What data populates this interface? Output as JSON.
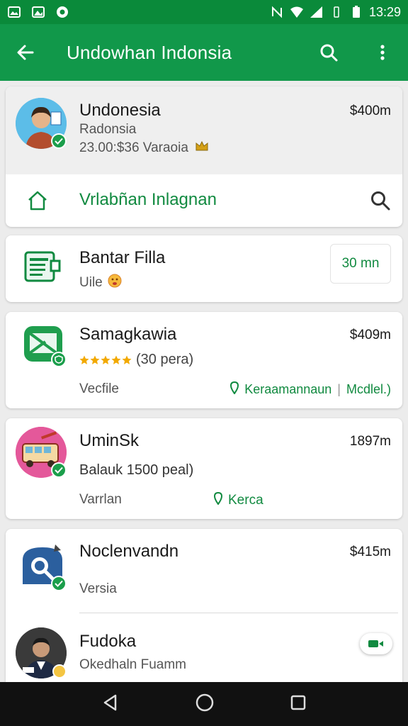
{
  "status_bar": {
    "time": "13:29",
    "icons": [
      "gallery-icon",
      "image-icon",
      "record-icon",
      "nfc-icon",
      "wifi-icon",
      "signal-icon",
      "vibrate-icon",
      "battery-icon"
    ]
  },
  "app_bar": {
    "title": "Undowhan Indonsia",
    "icons": [
      "back-arrow-icon",
      "search-icon",
      "more-vert-icon"
    ]
  },
  "colors": {
    "status_bar": "#0a8a3a",
    "app_bar": "#11984a",
    "accent_green": "#118a40",
    "verified": "#1b9e4b",
    "star": "#f2a900"
  },
  "profile_card": {
    "name": "Undonesia",
    "subtitle": "Radonsia",
    "detail": "23.00:$36 Varaoia",
    "price": "$400m",
    "search_row_label": "Vrlabñan Inlagnan"
  },
  "items": [
    {
      "title": "Bantar Filla",
      "subtitle": "Uile",
      "badge": "30 mn",
      "icon": "document-icon"
    },
    {
      "title": "Samagkawia",
      "price": "$409m",
      "rating_text": "(30 pera)",
      "stars": 5,
      "footer_left": "Vecfile",
      "footer_link": "Keraamannaun",
      "footer_sep": "|",
      "footer_right": "Mcdlel.)",
      "icon": "map-icon"
    },
    {
      "title": "UminSk",
      "price": "1897m",
      "subtitle": "Balauk 1500 peal)",
      "footer_left": "Varrlan",
      "footer_link": "Kerca",
      "icon": "bus-icon"
    },
    {
      "title": "Noclenvandn",
      "price": "$415m",
      "subtitle": "Versia",
      "icon": "magnifier-location-icon"
    },
    {
      "title": "Fudoka",
      "subtitle": "Okedhaln Fuamm",
      "icon": "person-avatar-icon",
      "action_icon": "video-icon"
    }
  ],
  "nav_bar": {
    "icons": [
      "back-triangle-icon",
      "home-circle-icon",
      "recents-square-icon"
    ]
  }
}
